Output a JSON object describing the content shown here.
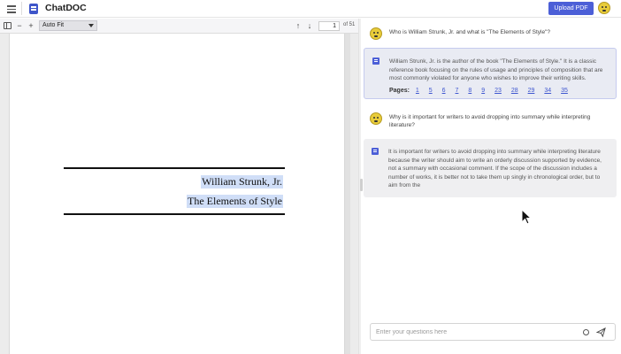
{
  "header": {
    "app_title": "ChatDOC",
    "upload_label": "Upload PDF",
    "menu_icon": "menu-icon",
    "logo_icon": "document-logo-icon",
    "accent_color": "#4c5fd7"
  },
  "pdf_toolbar": {
    "zoom_value": "Auto Fit",
    "page_number": "1",
    "page_total": "of 51",
    "icons": [
      "sidebar-toggle-icon",
      "zoom-out-icon",
      "zoom-in-icon",
      "arrow-up-icon",
      "arrow-down-icon"
    ]
  },
  "pdf_page": {
    "author": "William Strunk, Jr.",
    "title": "The Elements of Style",
    "highlight_color": "#d0def7"
  },
  "chat": {
    "messages": [
      {
        "role": "user",
        "text": "Who is William Strunk, Jr. and what is \"The Elements of Style\"?"
      },
      {
        "role": "assistant",
        "text": "William Strunk, Jr. is the author of the book \"The Elements of Style.\" It is a classic reference book focusing on the rules of usage and principles of composition that are most commonly violated for anyone who wishes to improve their writing skills.",
        "pages_label": "Pages:",
        "pages": [
          "1",
          "5",
          "6",
          "7",
          "8",
          "9",
          "23",
          "28",
          "29",
          "34",
          "35"
        ]
      },
      {
        "role": "user",
        "text": "Why is it important for writers to avoid dropping into summary while interpreting literature?"
      },
      {
        "role": "assistant",
        "text": "It is important for writers to avoid dropping into summary while interpreting literature because the writer should aim to write an orderly discussion supported by evidence, not a summary with occasional comment. If the scope of the discussion includes a number of works, it is better not to take them up singly in chronological order, but to aim from the"
      }
    ],
    "input_placeholder": "Enter your questions here",
    "input_value": ""
  }
}
